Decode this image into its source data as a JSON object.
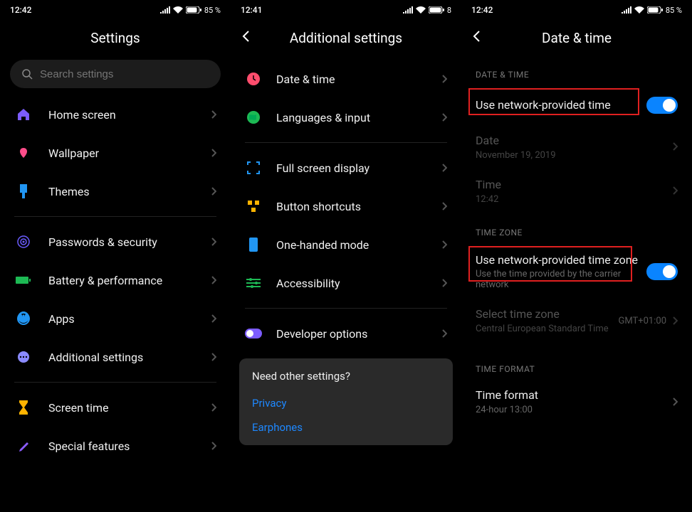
{
  "panel1": {
    "status": {
      "time": "12:42",
      "battery": "85 %"
    },
    "title": "Settings",
    "search_placeholder": "Search settings",
    "items": [
      {
        "label": "Home screen"
      },
      {
        "label": "Wallpaper"
      },
      {
        "label": "Themes"
      },
      {
        "label": "Passwords & security"
      },
      {
        "label": "Battery & performance"
      },
      {
        "label": "Apps"
      },
      {
        "label": "Additional settings"
      },
      {
        "label": "Screen time"
      },
      {
        "label": "Special features"
      }
    ]
  },
  "panel2": {
    "status": {
      "time": "12:41",
      "battery": "8"
    },
    "title": "Additional settings",
    "items": [
      {
        "label": "Date & time"
      },
      {
        "label": "Languages & input"
      },
      {
        "label": "Full screen display"
      },
      {
        "label": "Button shortcuts"
      },
      {
        "label": "One-handed mode"
      },
      {
        "label": "Accessibility"
      },
      {
        "label": "Developer options"
      }
    ],
    "other": {
      "title": "Need other settings?",
      "links": [
        "Privacy",
        "Earphones"
      ]
    }
  },
  "panel3": {
    "status": {
      "time": "12:42",
      "battery": "85 %"
    },
    "title": "Date & time",
    "section_date_time": "DATE & TIME",
    "use_network_time": "Use network-provided time",
    "date_label": "Date",
    "date_value": "November 19, 2019",
    "time_label": "Time",
    "time_value": "12:42",
    "section_time_zone": "TIME ZONE",
    "use_network_zone_title": "Use network-provided time zone",
    "use_network_zone_sub": "Use the time provided by the carrier network",
    "select_tz_label": "Select time zone",
    "select_tz_sub": "Central European Standard Time",
    "select_tz_value": "GMT+01:00",
    "section_time_format": "TIME FORMAT",
    "time_format_label": "Time format",
    "time_format_sub": "24-hour 13:00"
  }
}
